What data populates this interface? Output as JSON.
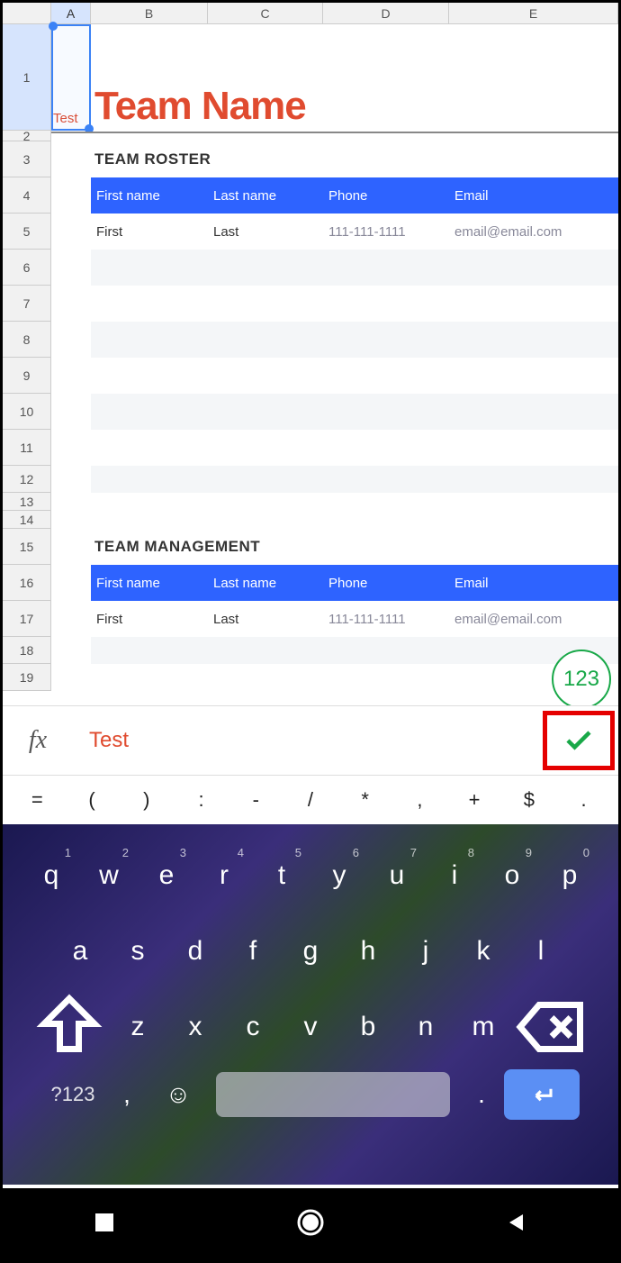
{
  "columns": [
    "A",
    "B",
    "C",
    "D",
    "E"
  ],
  "rows": [
    "1",
    "2",
    "3",
    "4",
    "5",
    "6",
    "7",
    "8",
    "9",
    "10",
    "11",
    "12",
    "13",
    "14",
    "15",
    "16",
    "17",
    "18",
    "19"
  ],
  "selected_cell_text": "Test",
  "title": "Team Name",
  "section1": {
    "heading": "TEAM ROSTER",
    "headers": [
      "First name",
      "Last name",
      "Phone",
      "Email"
    ],
    "row": {
      "first": "First",
      "last": "Last",
      "phone": "111-111-1111",
      "email": "email@email.com"
    }
  },
  "section2": {
    "heading": "TEAM MANAGEMENT",
    "headers": [
      "First name",
      "Last name",
      "Phone",
      "Email"
    ],
    "row": {
      "first": "First",
      "last": "Last",
      "phone": "111-111-1111",
      "email": "email@email.com"
    }
  },
  "fab_label": "123",
  "formula": {
    "fx": "fx",
    "value": "Test"
  },
  "symbols": [
    "=",
    "(",
    ")",
    ":",
    "-",
    "/",
    "*",
    ",",
    "+",
    "$",
    "."
  ],
  "keyboard": {
    "row1": [
      {
        "k": "q",
        "n": "1"
      },
      {
        "k": "w",
        "n": "2"
      },
      {
        "k": "e",
        "n": "3"
      },
      {
        "k": "r",
        "n": "4"
      },
      {
        "k": "t",
        "n": "5"
      },
      {
        "k": "y",
        "n": "6"
      },
      {
        "k": "u",
        "n": "7"
      },
      {
        "k": "i",
        "n": "8"
      },
      {
        "k": "o",
        "n": "9"
      },
      {
        "k": "p",
        "n": "0"
      }
    ],
    "row2": [
      "a",
      "s",
      "d",
      "f",
      "g",
      "h",
      "j",
      "k",
      "l"
    ],
    "row3": [
      "z",
      "x",
      "c",
      "v",
      "b",
      "n",
      "m"
    ],
    "alt": "?123",
    "comma": ",",
    "dot": "."
  }
}
